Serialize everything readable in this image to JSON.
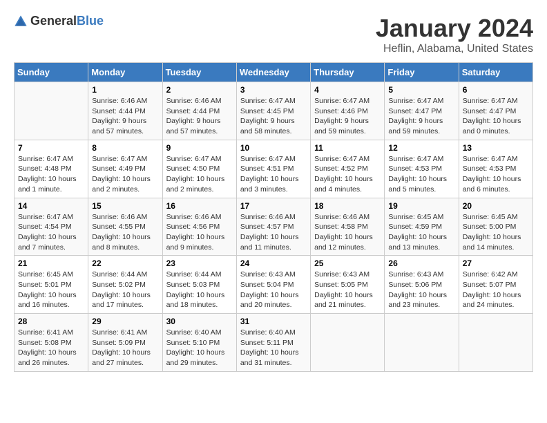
{
  "header": {
    "logo_general": "General",
    "logo_blue": "Blue",
    "title": "January 2024",
    "subtitle": "Heflin, Alabama, United States"
  },
  "calendar": {
    "days_of_week": [
      "Sunday",
      "Monday",
      "Tuesday",
      "Wednesday",
      "Thursday",
      "Friday",
      "Saturday"
    ],
    "weeks": [
      [
        {
          "day": "",
          "info": ""
        },
        {
          "day": "1",
          "info": "Sunrise: 6:46 AM\nSunset: 4:44 PM\nDaylight: 9 hours\nand 57 minutes."
        },
        {
          "day": "2",
          "info": "Sunrise: 6:46 AM\nSunset: 4:44 PM\nDaylight: 9 hours\nand 57 minutes."
        },
        {
          "day": "3",
          "info": "Sunrise: 6:47 AM\nSunset: 4:45 PM\nDaylight: 9 hours\nand 58 minutes."
        },
        {
          "day": "4",
          "info": "Sunrise: 6:47 AM\nSunset: 4:46 PM\nDaylight: 9 hours\nand 59 minutes."
        },
        {
          "day": "5",
          "info": "Sunrise: 6:47 AM\nSunset: 4:47 PM\nDaylight: 9 hours\nand 59 minutes."
        },
        {
          "day": "6",
          "info": "Sunrise: 6:47 AM\nSunset: 4:47 PM\nDaylight: 10 hours\nand 0 minutes."
        }
      ],
      [
        {
          "day": "7",
          "info": "Sunrise: 6:47 AM\nSunset: 4:48 PM\nDaylight: 10 hours\nand 1 minute."
        },
        {
          "day": "8",
          "info": "Sunrise: 6:47 AM\nSunset: 4:49 PM\nDaylight: 10 hours\nand 2 minutes."
        },
        {
          "day": "9",
          "info": "Sunrise: 6:47 AM\nSunset: 4:50 PM\nDaylight: 10 hours\nand 2 minutes."
        },
        {
          "day": "10",
          "info": "Sunrise: 6:47 AM\nSunset: 4:51 PM\nDaylight: 10 hours\nand 3 minutes."
        },
        {
          "day": "11",
          "info": "Sunrise: 6:47 AM\nSunset: 4:52 PM\nDaylight: 10 hours\nand 4 minutes."
        },
        {
          "day": "12",
          "info": "Sunrise: 6:47 AM\nSunset: 4:53 PM\nDaylight: 10 hours\nand 5 minutes."
        },
        {
          "day": "13",
          "info": "Sunrise: 6:47 AM\nSunset: 4:53 PM\nDaylight: 10 hours\nand 6 minutes."
        }
      ],
      [
        {
          "day": "14",
          "info": "Sunrise: 6:47 AM\nSunset: 4:54 PM\nDaylight: 10 hours\nand 7 minutes."
        },
        {
          "day": "15",
          "info": "Sunrise: 6:46 AM\nSunset: 4:55 PM\nDaylight: 10 hours\nand 8 minutes."
        },
        {
          "day": "16",
          "info": "Sunrise: 6:46 AM\nSunset: 4:56 PM\nDaylight: 10 hours\nand 9 minutes."
        },
        {
          "day": "17",
          "info": "Sunrise: 6:46 AM\nSunset: 4:57 PM\nDaylight: 10 hours\nand 11 minutes."
        },
        {
          "day": "18",
          "info": "Sunrise: 6:46 AM\nSunset: 4:58 PM\nDaylight: 10 hours\nand 12 minutes."
        },
        {
          "day": "19",
          "info": "Sunrise: 6:45 AM\nSunset: 4:59 PM\nDaylight: 10 hours\nand 13 minutes."
        },
        {
          "day": "20",
          "info": "Sunrise: 6:45 AM\nSunset: 5:00 PM\nDaylight: 10 hours\nand 14 minutes."
        }
      ],
      [
        {
          "day": "21",
          "info": "Sunrise: 6:45 AM\nSunset: 5:01 PM\nDaylight: 10 hours\nand 16 minutes."
        },
        {
          "day": "22",
          "info": "Sunrise: 6:44 AM\nSunset: 5:02 PM\nDaylight: 10 hours\nand 17 minutes."
        },
        {
          "day": "23",
          "info": "Sunrise: 6:44 AM\nSunset: 5:03 PM\nDaylight: 10 hours\nand 18 minutes."
        },
        {
          "day": "24",
          "info": "Sunrise: 6:43 AM\nSunset: 5:04 PM\nDaylight: 10 hours\nand 20 minutes."
        },
        {
          "day": "25",
          "info": "Sunrise: 6:43 AM\nSunset: 5:05 PM\nDaylight: 10 hours\nand 21 minutes."
        },
        {
          "day": "26",
          "info": "Sunrise: 6:43 AM\nSunset: 5:06 PM\nDaylight: 10 hours\nand 23 minutes."
        },
        {
          "day": "27",
          "info": "Sunrise: 6:42 AM\nSunset: 5:07 PM\nDaylight: 10 hours\nand 24 minutes."
        }
      ],
      [
        {
          "day": "28",
          "info": "Sunrise: 6:41 AM\nSunset: 5:08 PM\nDaylight: 10 hours\nand 26 minutes."
        },
        {
          "day": "29",
          "info": "Sunrise: 6:41 AM\nSunset: 5:09 PM\nDaylight: 10 hours\nand 27 minutes."
        },
        {
          "day": "30",
          "info": "Sunrise: 6:40 AM\nSunset: 5:10 PM\nDaylight: 10 hours\nand 29 minutes."
        },
        {
          "day": "31",
          "info": "Sunrise: 6:40 AM\nSunset: 5:11 PM\nDaylight: 10 hours\nand 31 minutes."
        },
        {
          "day": "",
          "info": ""
        },
        {
          "day": "",
          "info": ""
        },
        {
          "day": "",
          "info": ""
        }
      ]
    ]
  }
}
